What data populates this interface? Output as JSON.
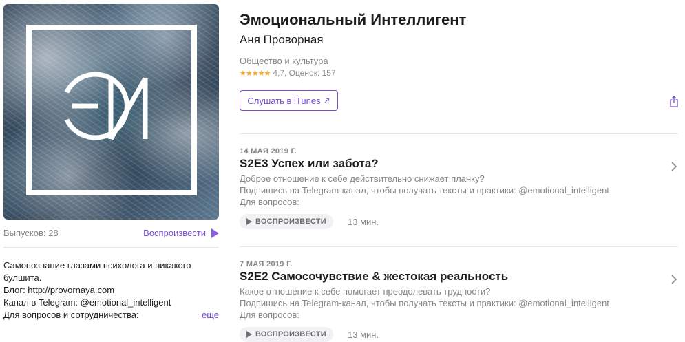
{
  "podcast": {
    "title": "Эмоциональный Интеллигент",
    "author": "Аня Проворная",
    "category": "Общество и культура",
    "stars": "★★★★★",
    "rating_text": "4,7, Оценок: 157",
    "listen_button": "Слушать в iTunes",
    "listen_arrow": "↗",
    "cover_logo": "ЭИ"
  },
  "sidebar": {
    "episodes_count": "Выпусков: 28",
    "play_label": "Воспроизвести",
    "description_lines": [
      "Самопознание глазами психолога и никакого",
      "булшита.",
      "Блог: http://provornaya.com",
      "Канал в Telegram: @emotional_intelligent",
      "Для вопросов и сотрудничества:"
    ],
    "more_label": "еще"
  },
  "episodes": [
    {
      "date": "14 МАЯ 2019 Г.",
      "title": "S2E3 Успех или забота?",
      "description_lines": [
        "Доброе отношение к себе действительно снижает планку?",
        "Подпишись на Telegram-канал, чтобы получать тексты и практики: @emotional_intelligent",
        "Для вопросов:"
      ],
      "play_label": "ВОСПРОИЗВЕСТИ",
      "duration": "13 мин."
    },
    {
      "date": "7 МАЯ 2019 Г.",
      "title": "S2E2 Самосочувствие & жестокая реальность",
      "description_lines": [
        "Какое отношение к себе помогает преодолевать трудности?",
        "Подпишись на Telegram-канал, чтобы получать тексты и практики: @emotional_intelligent",
        "Для вопросов:"
      ],
      "play_label": "ВОСПРОИЗВЕСТИ",
      "duration": "13 мин."
    }
  ],
  "icons": {
    "share": "share-icon",
    "chevron": "chevron-right-icon",
    "play": "play-icon"
  },
  "colors": {
    "accent": "#7a4bd1",
    "star": "#f5a623",
    "secondary_text": "#86868b"
  }
}
